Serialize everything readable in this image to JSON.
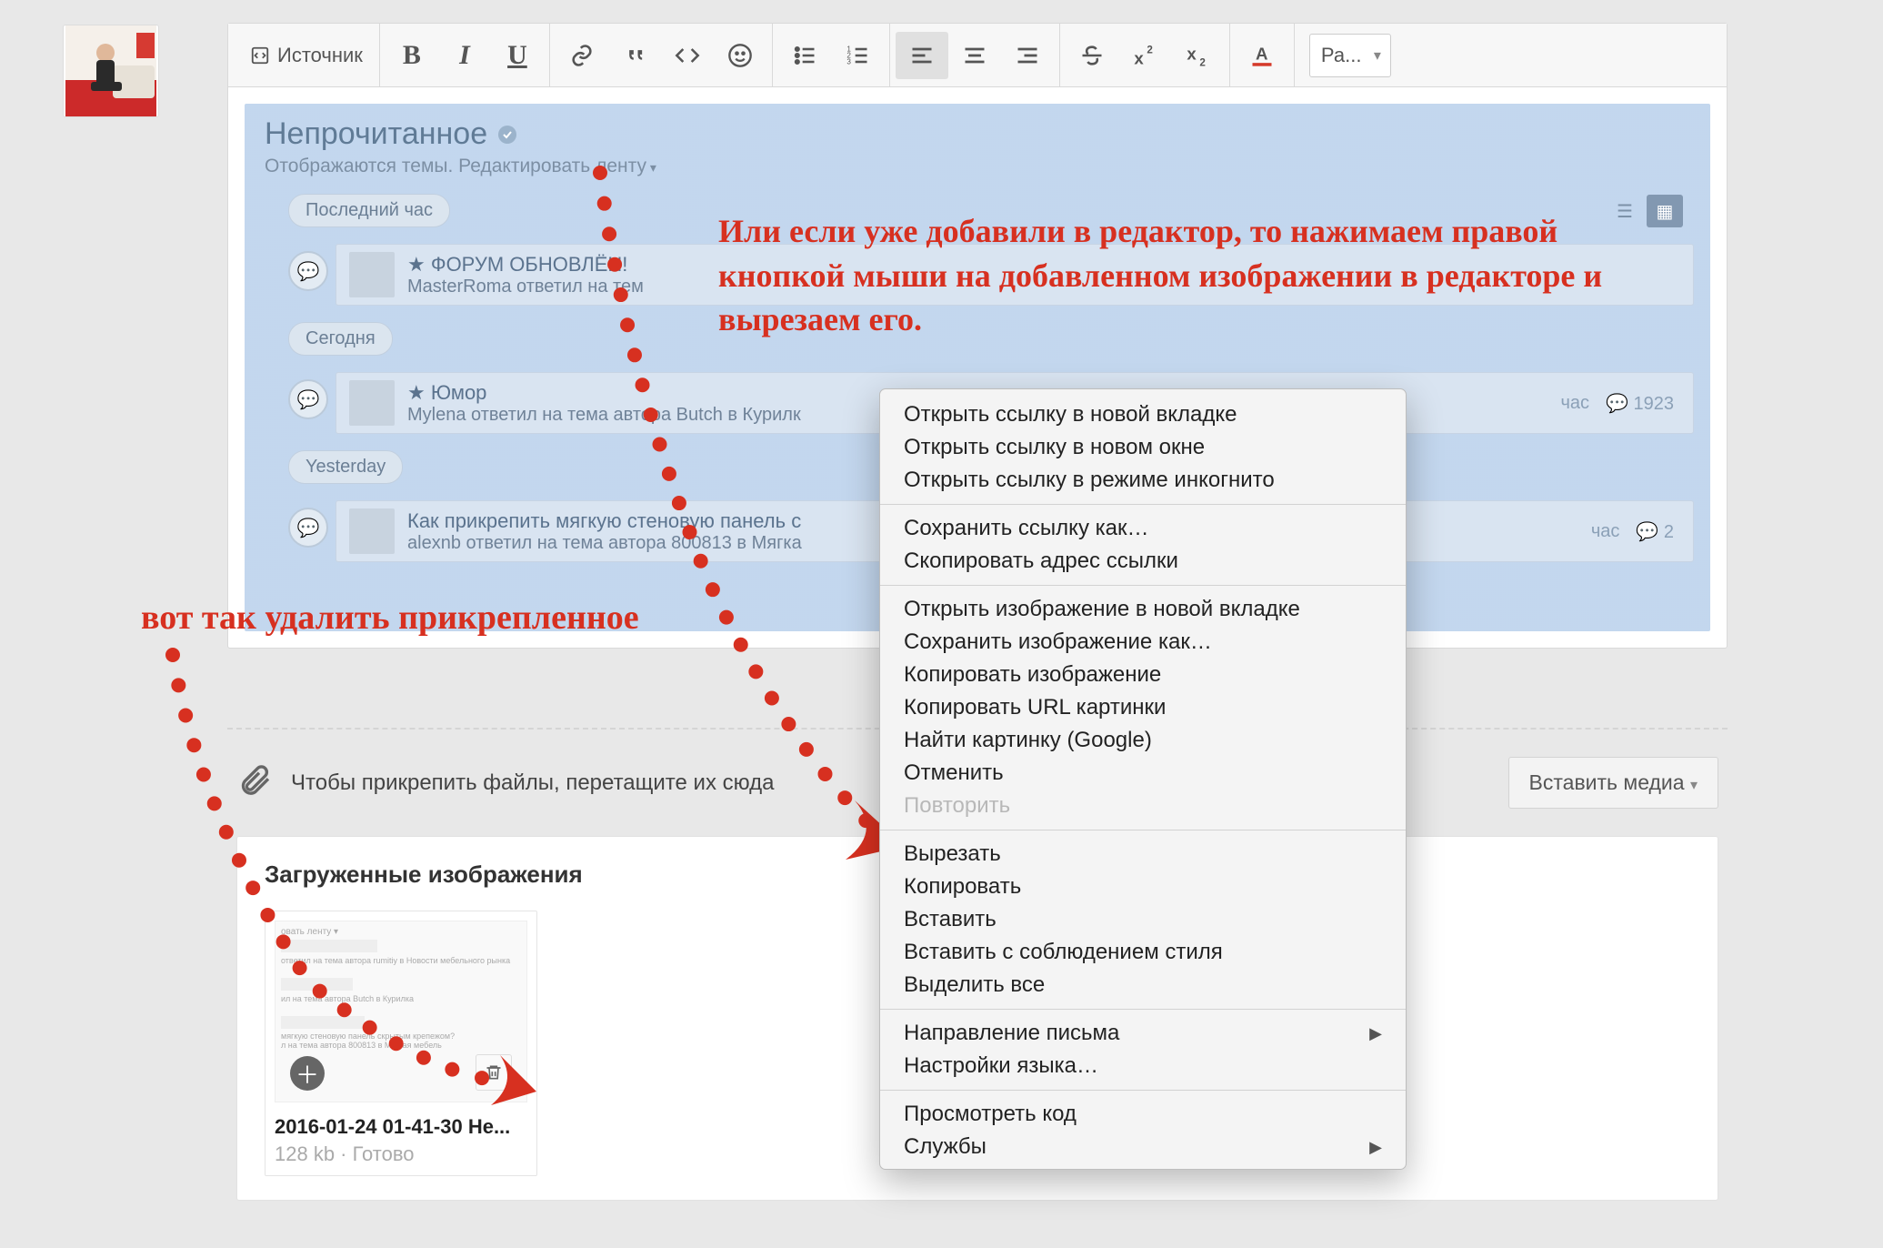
{
  "toolbar": {
    "source_label": "Источник",
    "size_label": "Ра..."
  },
  "forum_preview": {
    "title": "Непрочитанное",
    "subtitle_a": "Отображаются темы.",
    "subtitle_b": "Редактировать ленту",
    "badges": {
      "last_hour": "Последний час",
      "today": "Сегодня",
      "yesterday": "Yesterday"
    },
    "posts": {
      "p1_title": "ФОРУМ ОБНОВЛЁН!",
      "p1_meta": "MasterRoma ответил на тем",
      "p2_title": "★ Юмор",
      "p2_meta": "Mylena ответил на тема автора Butch в Курилк",
      "p2_time": "час",
      "p2_count": "1923",
      "p3_title": "Как прикрепить мягкую стеновую панель с",
      "p3_meta": "alexnb ответил на тема автора 800813 в Мягка",
      "p3_time": "час",
      "p3_count": "2"
    }
  },
  "attach": {
    "drag_text": "Чтобы прикрепить файлы, перетащите их сюда",
    "insert_media": "Вставить медиа",
    "uploaded_heading": "Загруженные изображения",
    "file_name": "2016-01-24 01-41-30 Не...",
    "file_status": "128 kb · Готово"
  },
  "context_menu": {
    "open_tab": "Открыть ссылку в новой вкладке",
    "open_window": "Открыть ссылку в новом окне",
    "open_incognito": "Открыть ссылку в режиме инкогнито",
    "save_link": "Сохранить ссылку как…",
    "copy_link": "Скопировать адрес ссылки",
    "open_img_tab": "Открыть изображение в новой вкладке",
    "save_img": "Сохранить изображение как…",
    "copy_img": "Копировать изображение",
    "copy_img_url": "Копировать URL картинки",
    "search_img": "Найти картинку (Google)",
    "undo": "Отменить",
    "redo": "Повторить",
    "cut": "Вырезать",
    "copy": "Копировать",
    "paste": "Вставить",
    "paste_style": "Вставить с соблюдением стиля",
    "select_all": "Выделить все",
    "direction": "Направление письма",
    "lang": "Настройки языка…",
    "inspect": "Просмотреть код",
    "services": "Службы"
  },
  "annotations": {
    "delete_hint": "вот так удалить прикрепленное",
    "rightclick_hint": "Или если уже добавили в редактор, то нажимаем правой кнопкой мыши на добавленном изображении в редакторе и вырезаем его."
  }
}
